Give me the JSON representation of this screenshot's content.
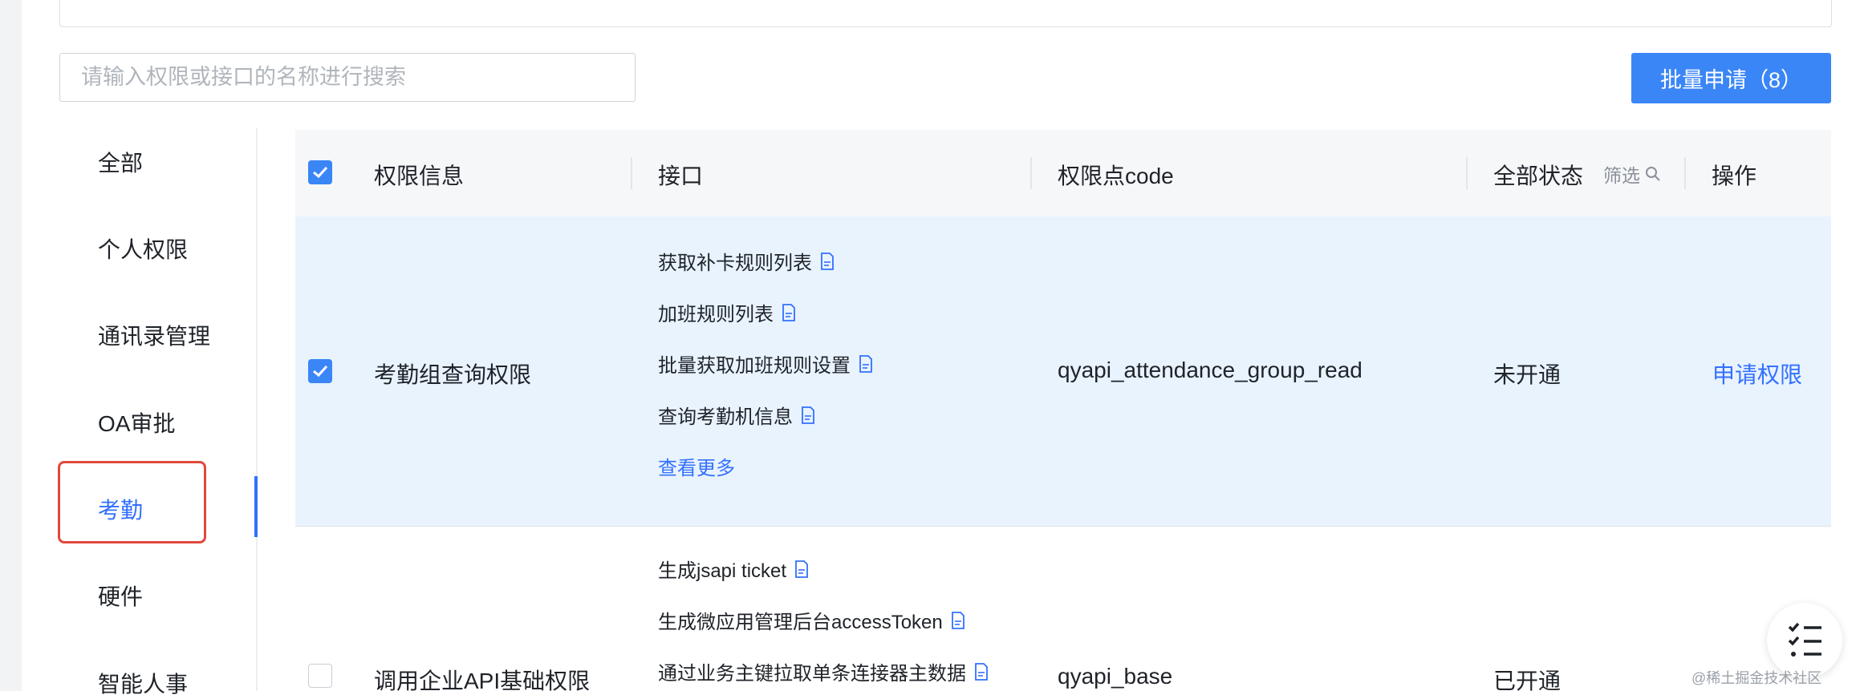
{
  "search": {
    "placeholder": "请输入权限或接口的名称进行搜索"
  },
  "batch_button": {
    "label": "批量申请（8）"
  },
  "sidebar": {
    "items": [
      {
        "label": "全部"
      },
      {
        "label": "个人权限"
      },
      {
        "label": "通讯录管理"
      },
      {
        "label": "OA审批"
      },
      {
        "label": "考勤",
        "active": true
      },
      {
        "label": "硬件"
      },
      {
        "label": "智能人事"
      }
    ]
  },
  "table": {
    "headers": {
      "permission_info": "权限信息",
      "interface": "接口",
      "code": "权限点code",
      "status": "全部状态",
      "filter": "筛选",
      "action": "操作"
    },
    "rows": [
      {
        "checked": true,
        "name": "考勤组查询权限",
        "interfaces": [
          "获取补卡规则列表",
          "加班规则列表",
          "批量获取加班规则设置",
          "查询考勤机信息"
        ],
        "more": "查看更多",
        "code": "qyapi_attendance_group_read",
        "status": "未开通",
        "action": "申请权限"
      },
      {
        "checked": false,
        "name": "调用企业API基础权限",
        "interfaces": [
          "生成jsapi ticket",
          "生成微应用管理后台accessToken",
          "通过业务主键拉取单条连接器主数据"
        ],
        "code": "qyapi_base",
        "status": "已开通"
      }
    ]
  },
  "watermark": "@稀土掘金技术社区",
  "colors": {
    "accent": "#3370ff",
    "button": "#3b86f7",
    "highlight": "#e0493c",
    "row_selected": "#e8f3fe"
  }
}
